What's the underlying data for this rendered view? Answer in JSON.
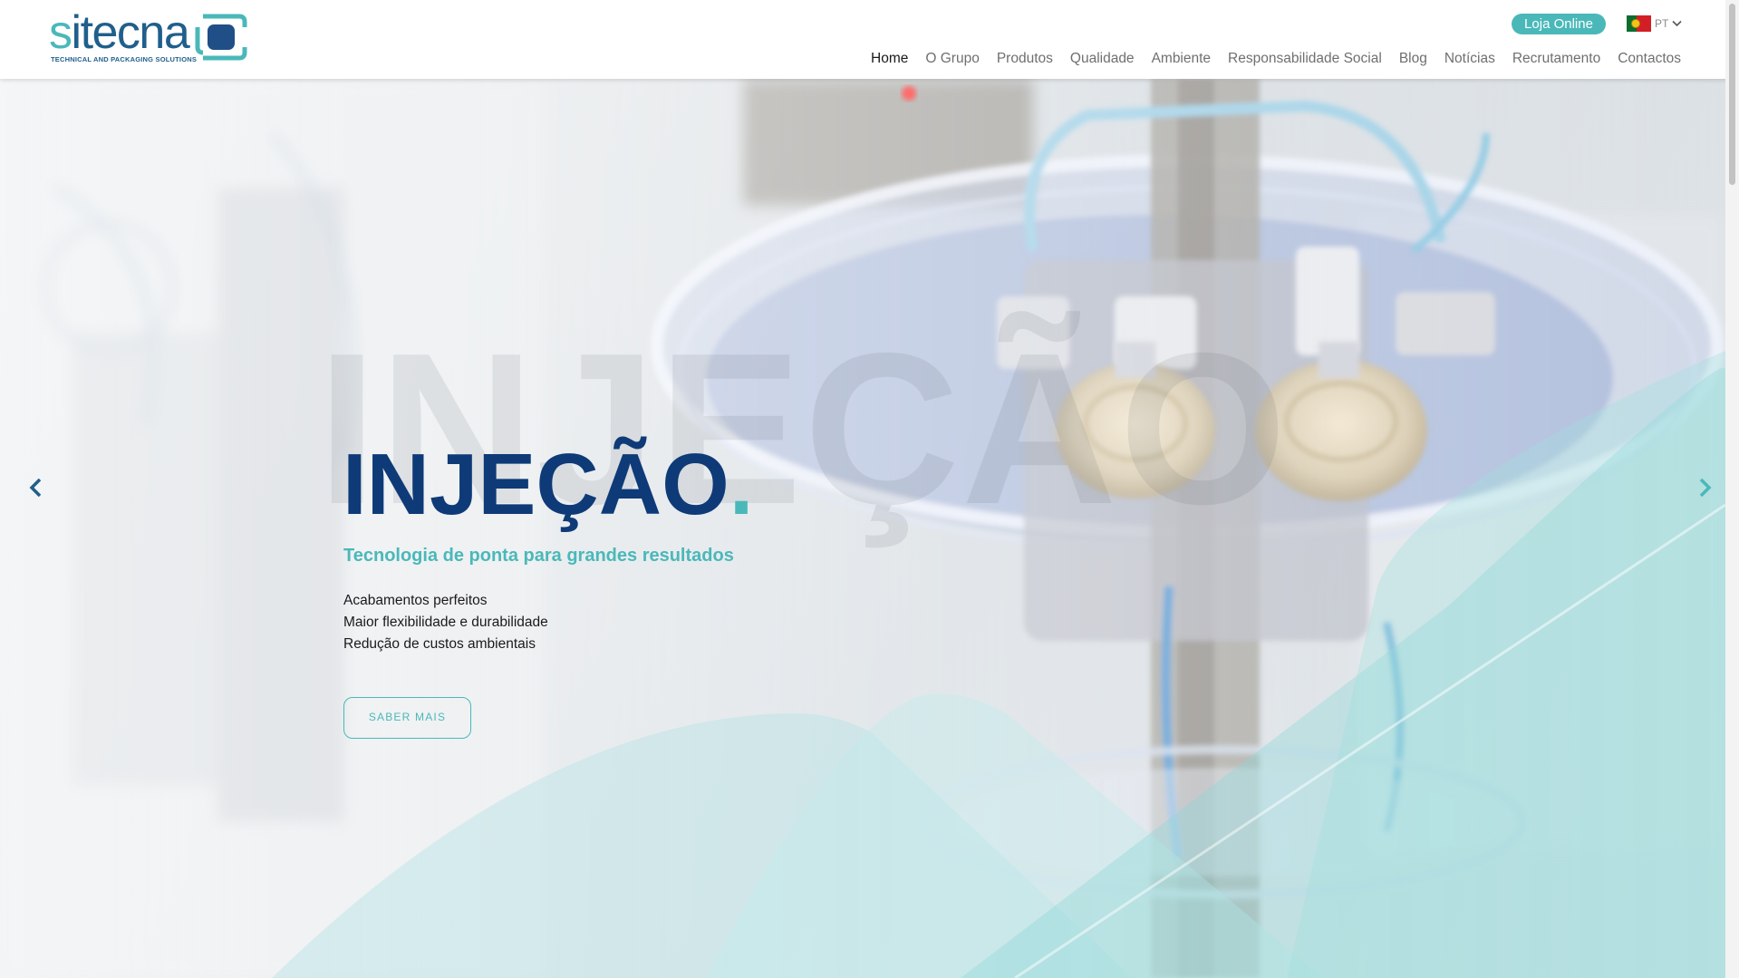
{
  "brand": {
    "name_main": "sitecna",
    "name_main_part1": "s",
    "name_main_part2": "i",
    "name_main_part3": "tecna",
    "tagline": "TECHNICAL AND PACKAGING SOLUTIONS"
  },
  "header": {
    "shop_button": "Loja Online",
    "language": {
      "code": "PT",
      "flag": "portugal-flag"
    },
    "nav": [
      {
        "label": "Home",
        "active": true
      },
      {
        "label": "O Grupo"
      },
      {
        "label": "Produtos"
      },
      {
        "label": "Qualidade"
      },
      {
        "label": "Ambiente"
      },
      {
        "label": "Responsabilidade Social"
      },
      {
        "label": "Blog"
      },
      {
        "label": "Notícias"
      },
      {
        "label": "Recrutamento"
      },
      {
        "label": "Contactos"
      }
    ]
  },
  "hero": {
    "ghost_title": "INJEÇÃO",
    "title": "INJEÇÃO",
    "title_dot": ".",
    "subtitle": "Tecnologia de ponta para grandes resultados",
    "features": [
      "Acabamentos perfeitos",
      "Maior flexibilidade e durabilidade",
      "Redução de custos ambientais"
    ],
    "cta": "SABER MAIS",
    "prev_icon": "chevron-left-icon",
    "next_icon": "chevron-right-icon"
  },
  "colors": {
    "brand_blue": "#0e3a78",
    "brand_teal": "#4ab8b9",
    "logo_blue": "#1f5f8b"
  }
}
